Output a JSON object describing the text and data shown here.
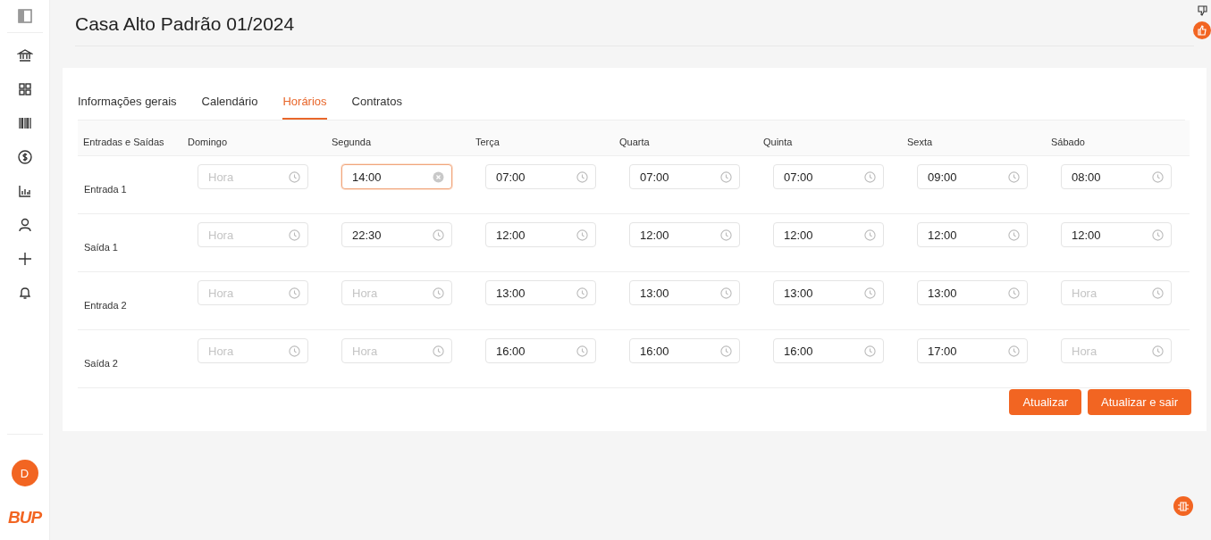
{
  "title": "Casa Alto Padrão 01/2024",
  "tabs": [
    {
      "label": "Informações gerais",
      "selected": false
    },
    {
      "label": "Calendário",
      "selected": false
    },
    {
      "label": "Horários",
      "selected": true
    },
    {
      "label": "Contratos",
      "selected": false
    }
  ],
  "table": {
    "columns": [
      "Entradas e Saídas",
      "Domingo",
      "Segunda",
      "Terça",
      "Quarta",
      "Quinta",
      "Sexta",
      "Sábado"
    ],
    "rows": [
      {
        "label": "Entrada 1",
        "fields": [
          {
            "placeholder": "Hora",
            "focused": false
          },
          {
            "value": "14:00",
            "focused": true
          },
          {
            "value": "07:00",
            "focused": false
          },
          {
            "value": "07:00",
            "focused": false
          },
          {
            "value": "07:00",
            "focused": false
          },
          {
            "value": "09:00",
            "focused": false
          },
          {
            "value": "08:00",
            "focused": false
          }
        ]
      },
      {
        "label": "Saída 1",
        "fields": [
          {
            "placeholder": "Hora",
            "focused": false
          },
          {
            "value": "22:30",
            "focused": false
          },
          {
            "value": "12:00",
            "focused": false
          },
          {
            "value": "12:00",
            "focused": false
          },
          {
            "value": "12:00",
            "focused": false
          },
          {
            "value": "12:00",
            "focused": false
          },
          {
            "value": "12:00",
            "focused": false
          }
        ]
      },
      {
        "label": "Entrada 2",
        "fields": [
          {
            "placeholder": "Hora",
            "focused": false
          },
          {
            "placeholder": "Hora",
            "focused": false
          },
          {
            "value": "13:00",
            "focused": false
          },
          {
            "value": "13:00",
            "focused": false
          },
          {
            "value": "13:00",
            "focused": false
          },
          {
            "value": "13:00",
            "focused": false
          },
          {
            "placeholder": "Hora",
            "focused": false
          }
        ]
      },
      {
        "label": "Saída 2",
        "fields": [
          {
            "placeholder": "Hora",
            "focused": false
          },
          {
            "placeholder": "Hora",
            "focused": false
          },
          {
            "value": "16:00",
            "focused": false
          },
          {
            "value": "16:00",
            "focused": false
          },
          {
            "value": "16:00",
            "focused": false
          },
          {
            "value": "17:00",
            "focused": false
          },
          {
            "placeholder": "Hora",
            "focused": false
          }
        ]
      }
    ]
  },
  "buttons": [
    "Atualizar",
    "Atualizar e sair"
  ],
  "user": {
    "initial": "D"
  },
  "logo": "BUP"
}
